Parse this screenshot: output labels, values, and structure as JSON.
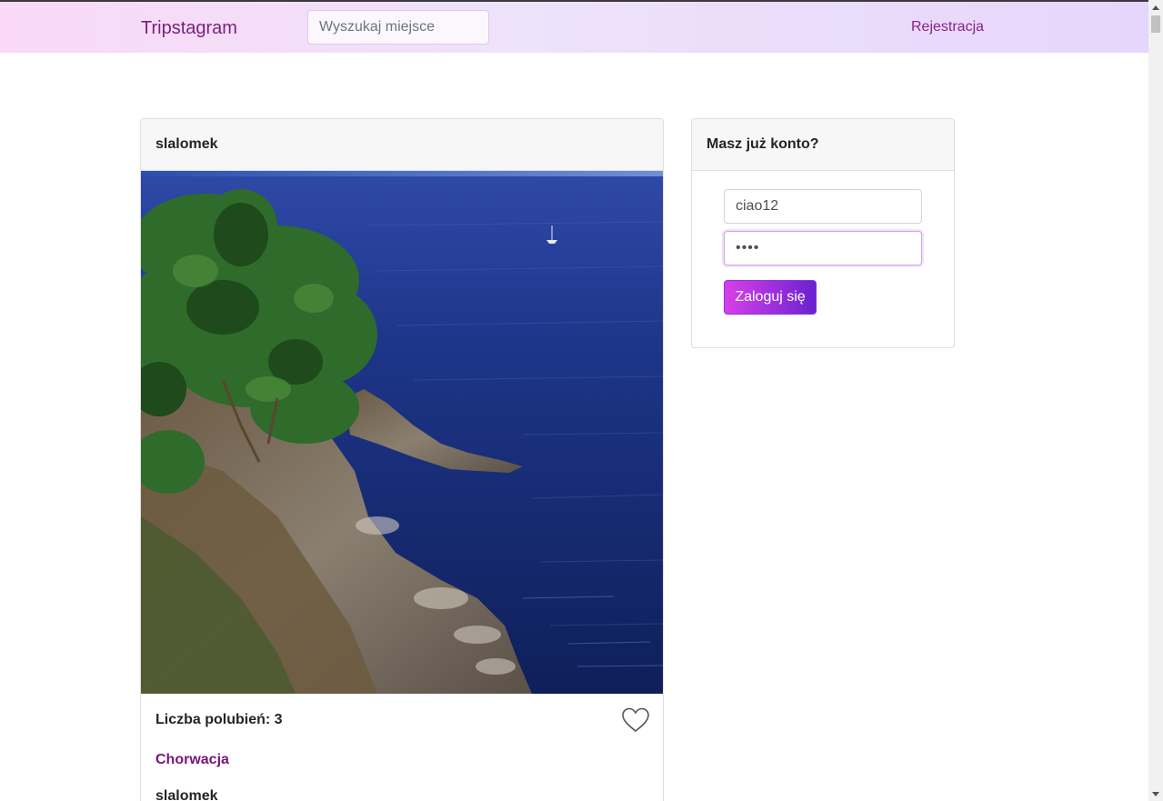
{
  "navbar": {
    "brand": "Tripstagram",
    "search_placeholder": "Wyszukaj miejsce",
    "register_label": "Rejestracja"
  },
  "post": {
    "author": "slalomek",
    "likes_text": "Liczba polubień: 3",
    "place": "Chorwacja",
    "footer_author": "slalomek",
    "photo_icon": "coastal-cliff-sea-photo",
    "heart_icon": "heart-outline-icon"
  },
  "login": {
    "title": "Masz już konto?",
    "username_value": "ciao12",
    "password_value": "••••",
    "submit_label": "Zaloguj się"
  },
  "colors": {
    "brand": "#7b1f7b",
    "accent_gradient_start": "#d740ea",
    "accent_gradient_end": "#6a22cf",
    "place_link": "#7a137a"
  }
}
